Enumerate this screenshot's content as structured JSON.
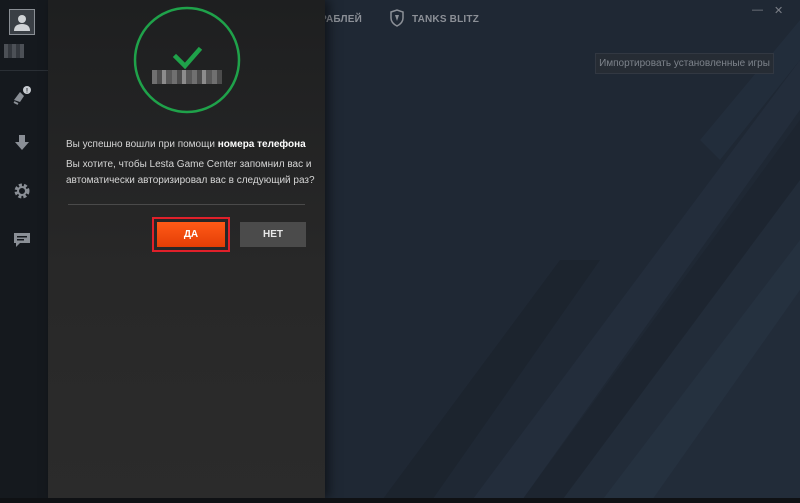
{
  "top_tabs": {
    "ships_partial": "ОРАБЛЕЙ",
    "tanks_blitz": "TANKS BLITZ"
  },
  "window_controls": {
    "minimize": "—",
    "close": "✕"
  },
  "import_button": {
    "label": "Импортировать установленные игры"
  },
  "sidebar": {
    "icons": [
      "avatar-icon",
      "news-icon",
      "download-icon",
      "settings-icon",
      "chat-icon"
    ]
  },
  "dialog": {
    "message_prefix": "Вы успешно вошли при помощи ",
    "message_bold": "номера телефона",
    "question": "Вы хотите, чтобы Lesta Game Center запомнил вас и автоматически авторизировал вас в следующий раз?",
    "yes_label": "ДА",
    "no_label": "НЕТ"
  },
  "colors": {
    "accent_orange": "#ff4f0f",
    "success_green": "#1fa24a",
    "highlight_red": "#e0202a"
  }
}
